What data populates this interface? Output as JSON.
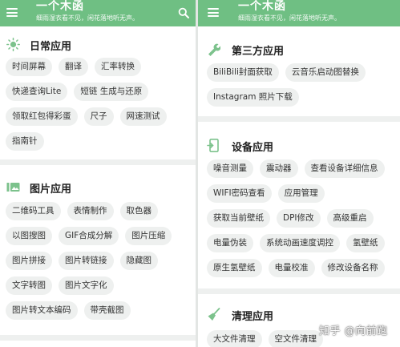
{
  "app": {
    "title": "一个木函",
    "subtitle": "细雨湿衣看不见，闲花落地听无声。"
  },
  "left_sections": [
    {
      "title": "日常应用",
      "icon": "sun-icon",
      "rows": [
        [
          "时间屏幕",
          "翻译",
          "汇率转换"
        ],
        [
          "快递查询Lite",
          "短链 生成与还原"
        ],
        [
          "领取红包得彩蛋",
          "尺子",
          "网速测试"
        ],
        [
          "指南针"
        ]
      ]
    },
    {
      "title": "图片应用",
      "icon": "image-icon",
      "rows": [
        [
          "二维码工具",
          "表情制作",
          "取色器"
        ],
        [
          "以图搜图",
          "GIF合成分解",
          "图片压缩"
        ],
        [
          "图片拼接",
          "图片转链接",
          "隐藏图"
        ],
        [
          "文字转图",
          "图片文字化"
        ],
        [
          "图片转文本编码",
          "带壳截图"
        ]
      ]
    }
  ],
  "right_sections": [
    {
      "title": "第三方应用",
      "icon": "wrench-icon",
      "rows": [
        [
          "BiliBili封面获取",
          "云音乐启动图替换"
        ],
        [
          "Instagram 照片下载"
        ]
      ]
    },
    {
      "title": "设备应用",
      "icon": "device-icon",
      "rows": [
        [
          "噪音测量",
          "震动器",
          "查看设备详细信息"
        ],
        [
          "WIFI密码查看",
          "应用管理"
        ],
        [
          "获取当前壁纸",
          "DPI修改",
          "高级重启"
        ],
        [
          "电量伪装",
          "系统动画速度调控",
          "氢壁纸"
        ],
        [
          "原生氢壁纸",
          "电量校准",
          "修改设备名称"
        ]
      ]
    },
    {
      "title": "清理应用",
      "icon": "broom-icon",
      "rows": [
        [
          "大文件清理",
          "空文件清理"
        ]
      ]
    }
  ],
  "watermark": "知乎 @向前跑",
  "colors": {
    "appbar": "#6fbf83",
    "chip": "#eef0ef",
    "separator": "#eef0ef"
  }
}
